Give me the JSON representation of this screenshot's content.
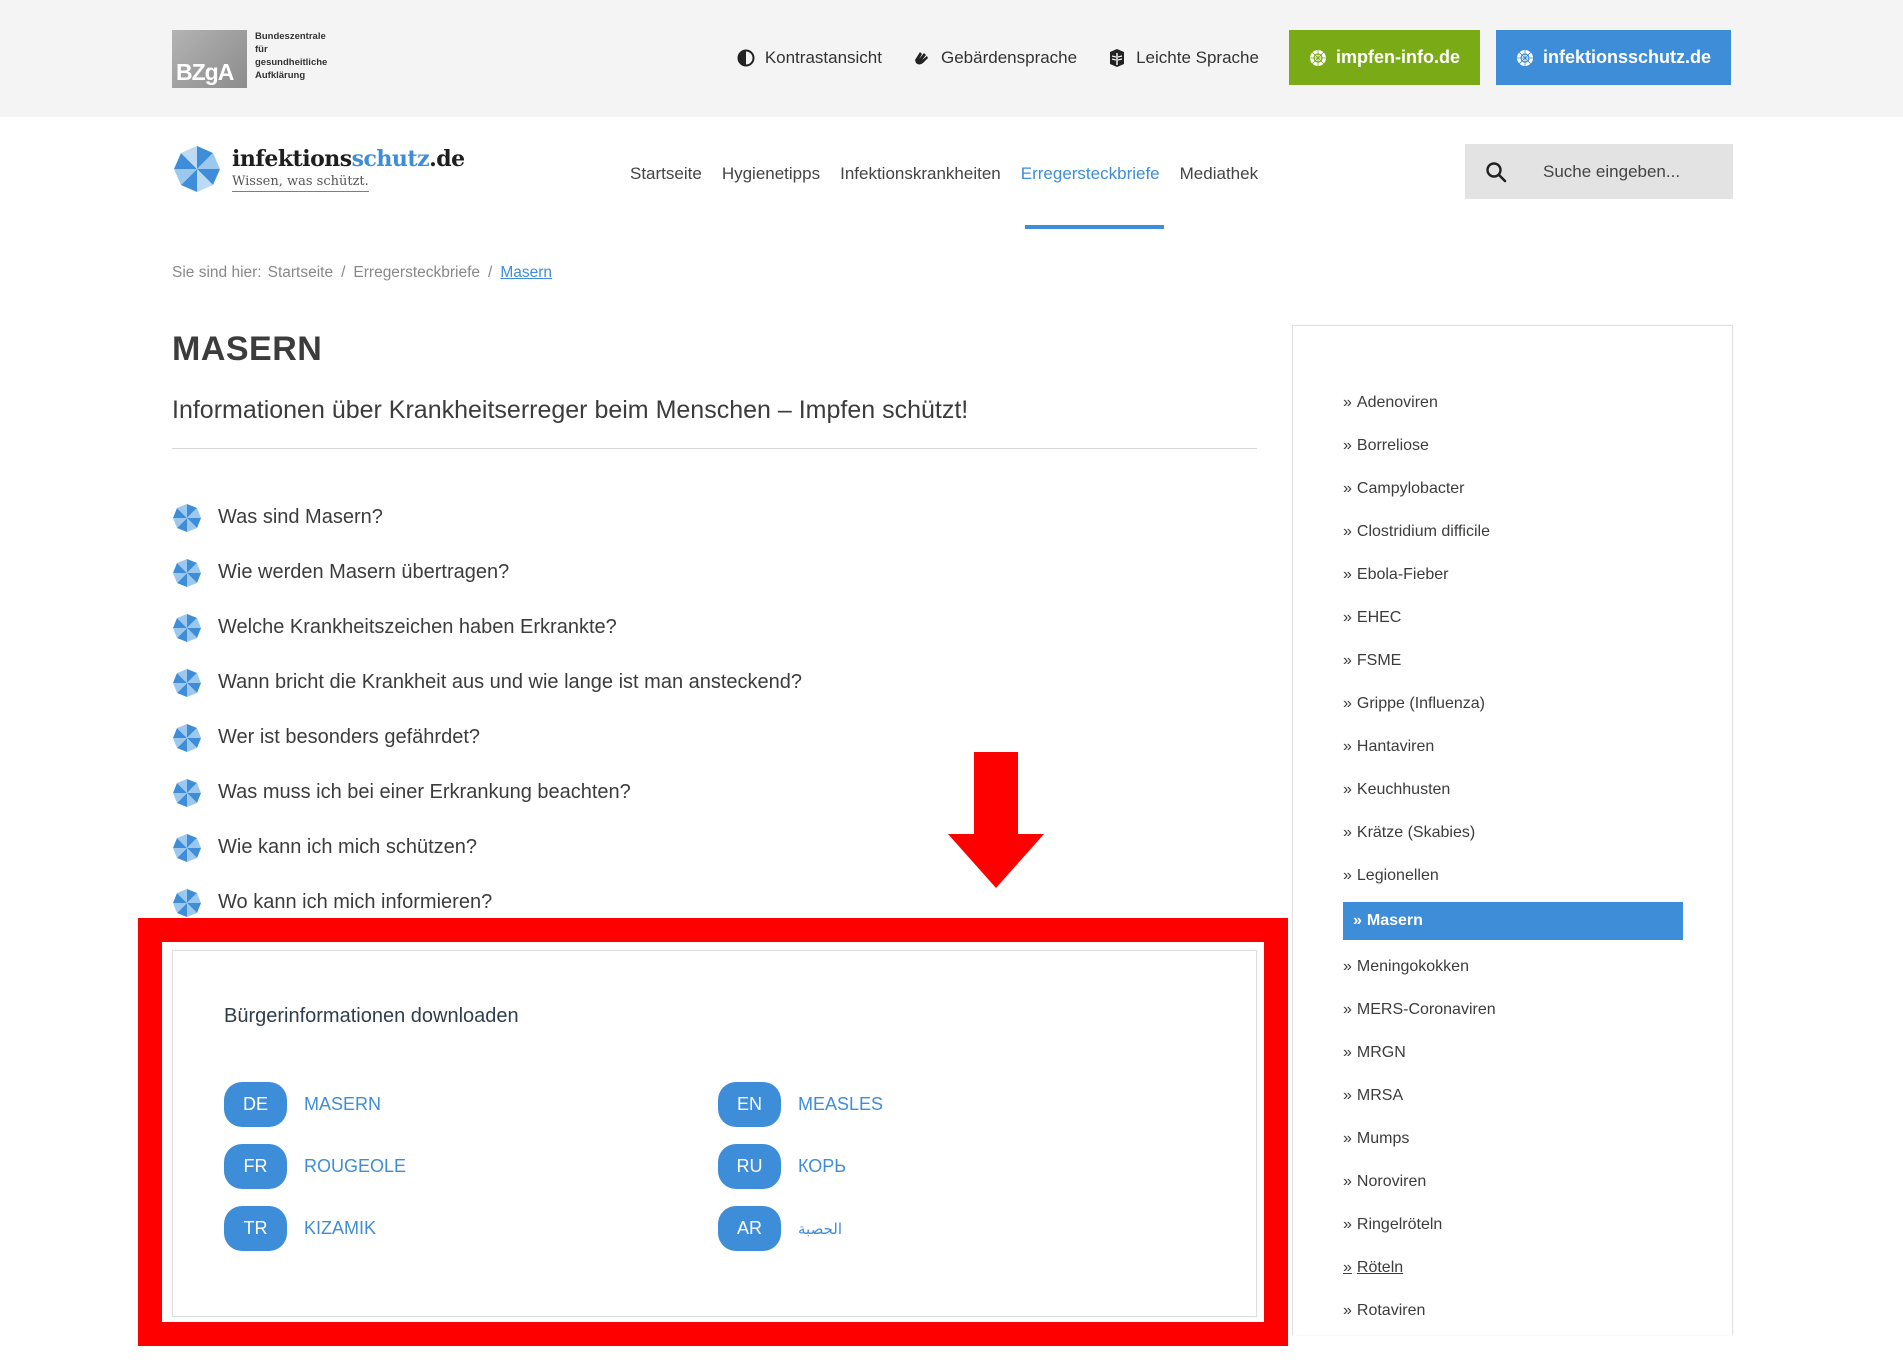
{
  "topbar": {
    "bzga_logo_text": "BZgA",
    "bzga_lines": [
      "Bundeszentrale",
      "für",
      "gesundheitliche",
      "Aufklärung"
    ],
    "contrast_label": "Kontrastansicht",
    "sign_language_label": "Gebärdensprache",
    "easy_language_label": "Leichte Sprache",
    "impfen_button": "impfen-info.de",
    "infektionsschutz_button": "infektionsschutz.de",
    "green_color": "#7aaa16",
    "blue_color": "#3e8dd8"
  },
  "header": {
    "logo_name_a": "infektions",
    "logo_name_b": "schutz",
    "logo_name_c": ".de",
    "logo_tagline": "Wissen, was schützt.",
    "nav": [
      {
        "label": "Startseite",
        "active": false
      },
      {
        "label": "Hygienetipps",
        "active": false
      },
      {
        "label": "Infektionskrankheiten",
        "active": false
      },
      {
        "label": "Erregersteckbriefe",
        "active": true
      },
      {
        "label": "Mediathek",
        "active": false
      }
    ],
    "search_placeholder": "Suche eingeben..."
  },
  "breadcrumb": {
    "prefix": "Sie sind hier:",
    "items": [
      "Startseite",
      "Erregersteckbriefe",
      "Masern"
    ]
  },
  "main": {
    "title": "MASERN",
    "subtitle": "Informationen über Krankheitserreger beim Menschen – Impfen schützt!",
    "faq": [
      "Was sind Masern?",
      "Wie werden Masern übertragen?",
      "Welche Krankheitszeichen haben Erkrankte?",
      "Wann bricht die Krankheit aus und wie lange ist man ansteckend?",
      "Wer ist besonders gefährdet?",
      "Was muss ich bei einer Erkrankung beachten?",
      "Wie kann ich mich schützen?",
      "Wo kann ich mich informieren?"
    ],
    "downloads": {
      "title": "Bürgerinformationen downloaden",
      "items": [
        {
          "lang": "DE",
          "label": "MASERN"
        },
        {
          "lang": "EN",
          "label": "MEASLES"
        },
        {
          "lang": "FR",
          "label": "ROUGEOLE"
        },
        {
          "lang": "RU",
          "label": "КОРЬ"
        },
        {
          "lang": "TR",
          "label": "KIZAMIK"
        },
        {
          "lang": "AR",
          "label": "الحصبة"
        }
      ]
    },
    "highlight_color": "#ff0000"
  },
  "sidebar": {
    "items": [
      {
        "label": "Adenoviren",
        "state": "normal"
      },
      {
        "label": "Borreliose",
        "state": "normal"
      },
      {
        "label": "Campylobacter",
        "state": "normal"
      },
      {
        "label": "Clostridium difficile",
        "state": "normal"
      },
      {
        "label": "Ebola-Fieber",
        "state": "normal"
      },
      {
        "label": "EHEC",
        "state": "normal"
      },
      {
        "label": "FSME",
        "state": "normal"
      },
      {
        "label": "Grippe (Influenza)",
        "state": "normal"
      },
      {
        "label": "Hantaviren",
        "state": "normal"
      },
      {
        "label": "Keuchhusten",
        "state": "normal"
      },
      {
        "label": "Krätze (Skabies)",
        "state": "normal"
      },
      {
        "label": "Legionellen",
        "state": "normal"
      },
      {
        "label": "Masern",
        "state": "active"
      },
      {
        "label": "Meningokokken",
        "state": "normal"
      },
      {
        "label": "MERS-Coronaviren",
        "state": "normal"
      },
      {
        "label": "MRGN",
        "state": "normal"
      },
      {
        "label": "MRSA",
        "state": "normal"
      },
      {
        "label": "Mumps",
        "state": "normal"
      },
      {
        "label": "Noroviren",
        "state": "normal"
      },
      {
        "label": "Ringelröteln",
        "state": "normal"
      },
      {
        "label": "Röteln",
        "state": "link"
      },
      {
        "label": "Rotaviren",
        "state": "normal"
      }
    ]
  }
}
